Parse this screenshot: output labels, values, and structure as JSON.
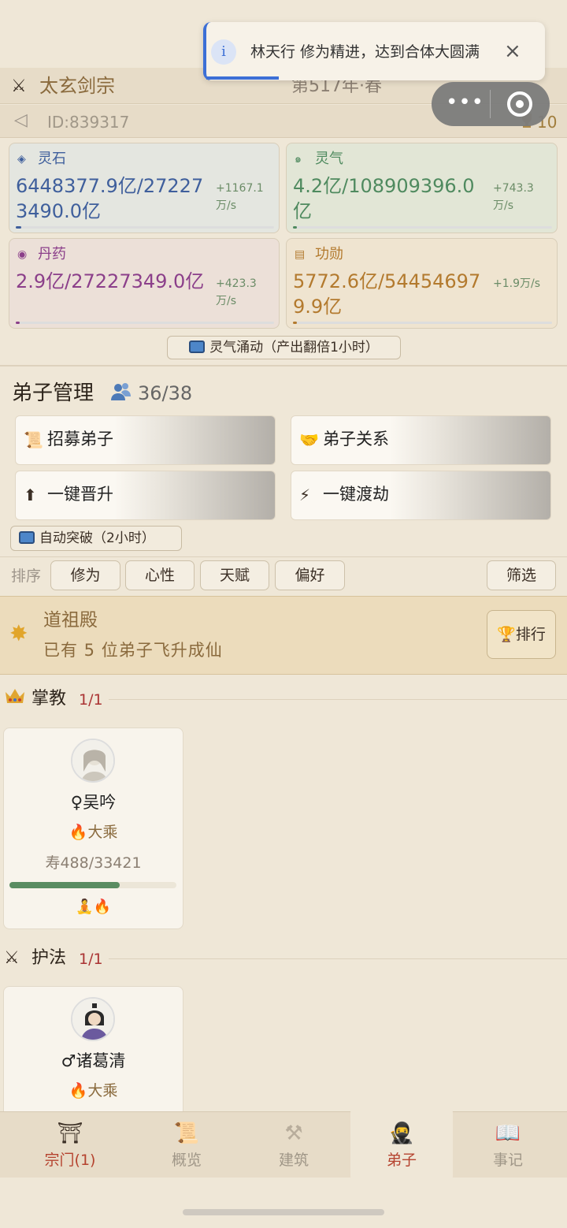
{
  "header": {
    "sect_name": "太玄剑宗",
    "year": "第517年·春",
    "id": "ID:839317",
    "trophy_count": "10"
  },
  "toast": {
    "message": "林天行 修为精进，达到合体大圆满",
    "close": "×",
    "info": "i"
  },
  "capsule": {
    "dots": "•••"
  },
  "resources": [
    {
      "icon": "spirit-stone-icon",
      "name": "灵石",
      "value": "6448377.9亿/272273490.0亿",
      "rate": "+1167.1万/s",
      "color": "#3f5f9c",
      "bg": "#e4e6e0",
      "fill": 0.02
    },
    {
      "icon": "spirit-qi-icon",
      "name": "灵气",
      "value": "4.2亿/108909396.0亿",
      "rate": "+743.3万/s",
      "color": "#4f8a5f",
      "bg": "#e2e6d6",
      "fill": 0.0
    },
    {
      "icon": "pill-icon",
      "name": "丹药",
      "value": "2.9亿/27227349.0亿",
      "rate": "+423.3万/s",
      "color": "#8b3f8a",
      "bg": "#ece0d8",
      "fill": 0.0
    },
    {
      "icon": "merit-icon",
      "name": "功勋",
      "value": "5772.6亿/544546979.9亿",
      "rate": "+1.9万/s",
      "color": "#b37a2e",
      "bg": "#efe4d0",
      "fill": 0.0
    }
  ],
  "boost_button": "灵气涌动（产出翻倍1小时）",
  "disciples": {
    "title": "弟子管理",
    "count": "36/38",
    "actions": [
      {
        "label": "招募弟子",
        "icon": "scroll-icon"
      },
      {
        "label": "弟子关系",
        "icon": "handshake-icon"
      },
      {
        "label": "一键晋升",
        "icon": "arrow-up-icon"
      },
      {
        "label": "一键渡劫",
        "icon": "lightning-icon"
      }
    ],
    "auto_breakthrough": "自动突破（2小时）"
  },
  "sort": {
    "label": "排序",
    "chips": [
      "修为",
      "心性",
      "天赋",
      "偏好"
    ],
    "filter": "筛选"
  },
  "hall": {
    "title": "道祖殿",
    "desc": "已有 5 位弟子飞升成仙",
    "rank_button": "排行"
  },
  "roles": [
    {
      "name": "掌教",
      "count": "1/1",
      "icon": "crown-icon"
    },
    {
      "name": "护法",
      "count": "1/1",
      "icon": "crossed-swords-icon"
    }
  ],
  "cards": [
    {
      "name": "♀吴吟",
      "realm": "大乘",
      "life": "寿488/33421",
      "life_fill": 0.66,
      "status": "🧘🔥"
    },
    {
      "name": "♂诸葛清",
      "realm": "大乘"
    }
  ],
  "tabs": [
    {
      "label": "宗门(1)",
      "icon": "temple-icon",
      "color": "#b5432f"
    },
    {
      "label": "概览",
      "icon": "scroll-icon",
      "color": "#a09788"
    },
    {
      "label": "建筑",
      "icon": "tools-icon",
      "color": "#a09788"
    },
    {
      "label": "弟子",
      "icon": "disciple-icon",
      "color": "#b5432f"
    },
    {
      "label": "事记",
      "icon": "book-icon",
      "color": "#a09788"
    }
  ]
}
